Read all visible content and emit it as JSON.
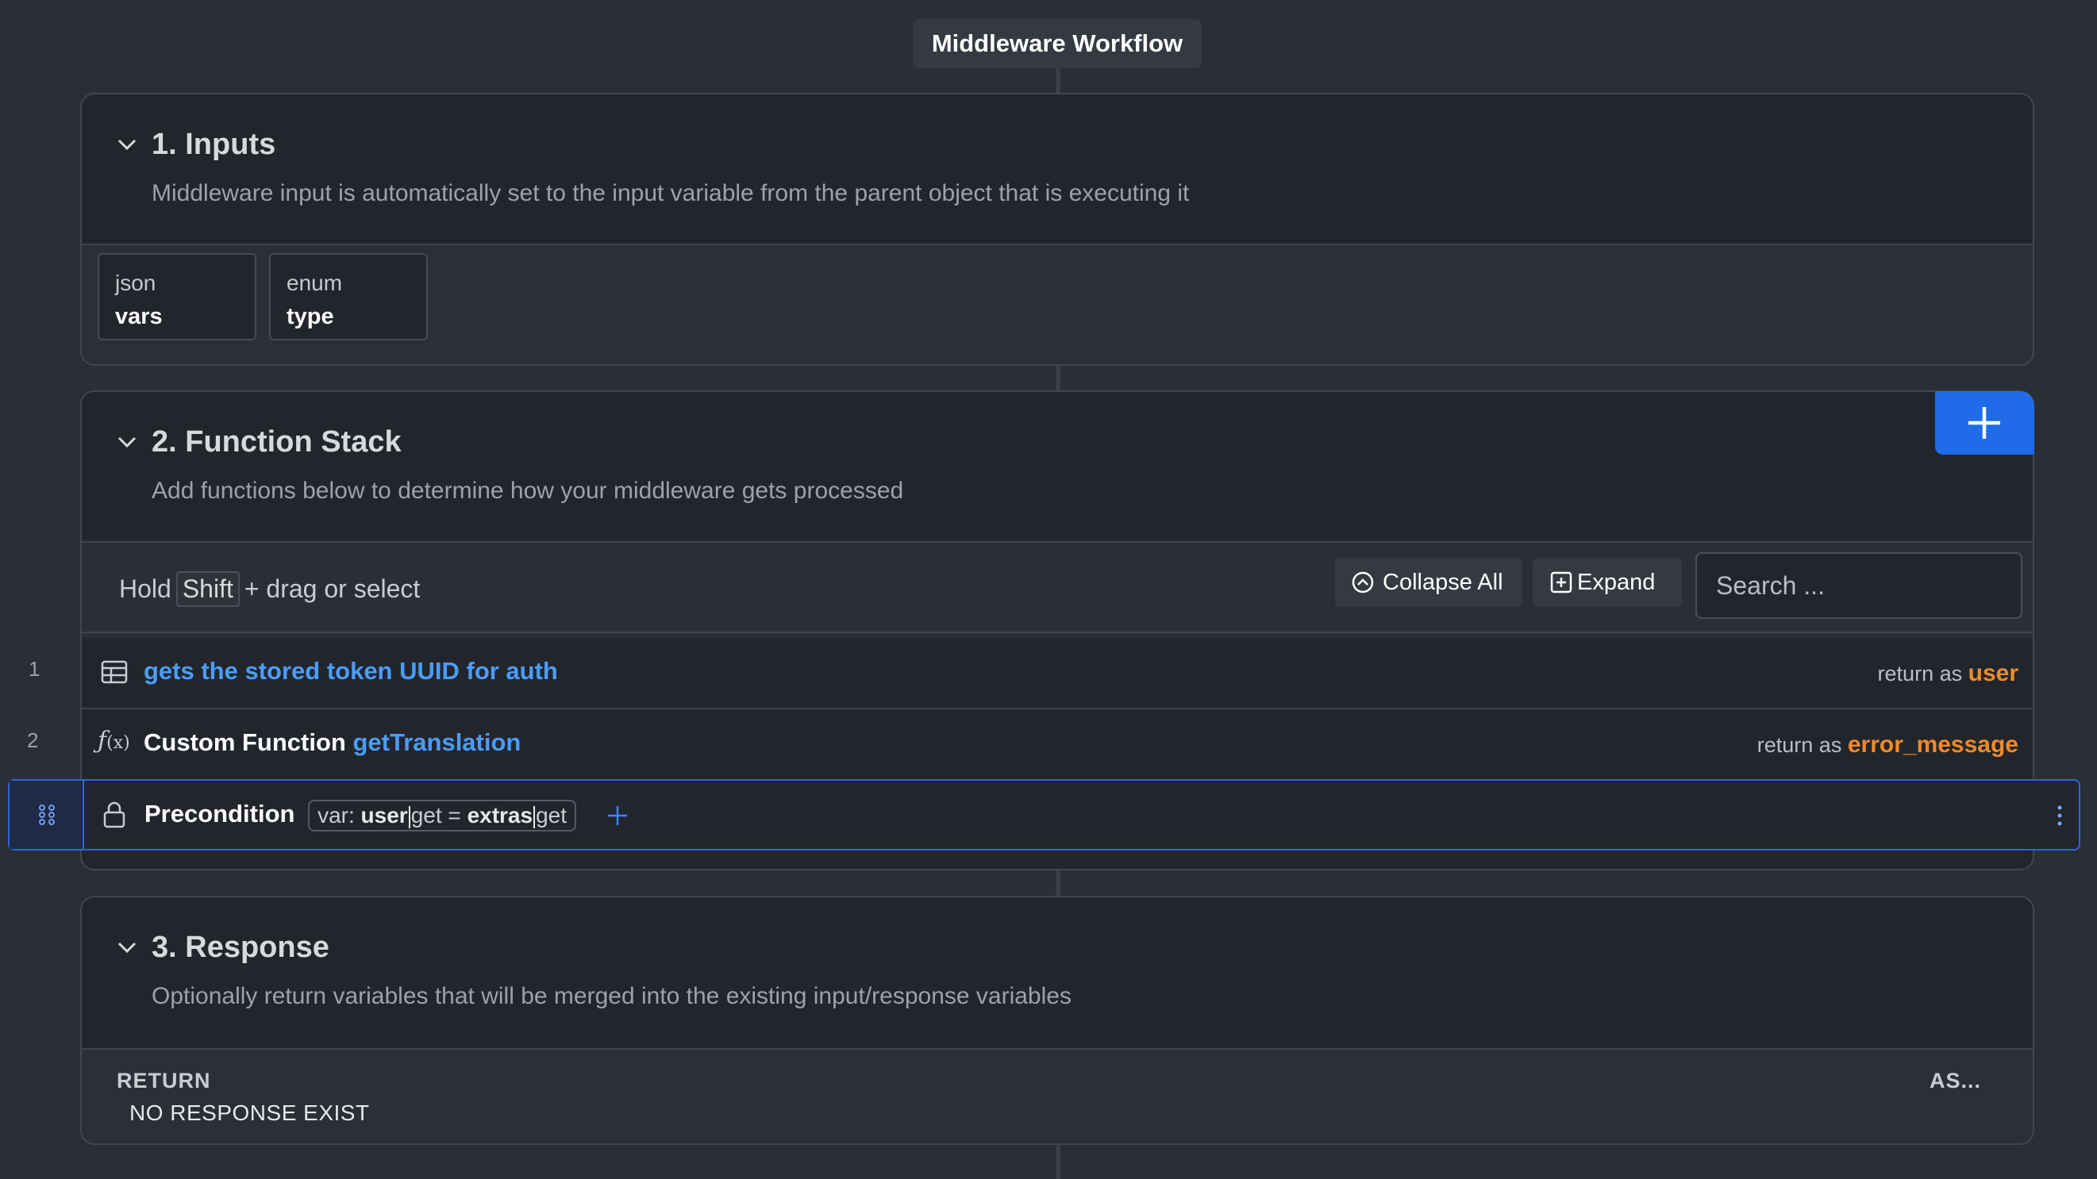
{
  "workflow": {
    "title": "Middleware Workflow"
  },
  "inputs": {
    "title": "1. Inputs",
    "subtitle": "Middleware input is automatically set to the input variable from the parent object that is executing it",
    "items": [
      {
        "type": "json",
        "name": "vars"
      },
      {
        "type": "enum",
        "name": "type"
      }
    ]
  },
  "function_stack": {
    "title": "2. Function Stack",
    "subtitle": "Add functions below to determine how your middleware gets processed",
    "add_button_icon": "plus-icon",
    "toolbar": {
      "hint_pre": "Hold",
      "hint_key": "Shift",
      "hint_post": "+ drag or select",
      "collapse_label": "Collapse All",
      "expand_label": "Expand",
      "search_placeholder": "Search ..."
    },
    "rows": [
      {
        "number": "1",
        "icon": "table-icon",
        "label": "gets the stored token UUID for auth",
        "return_prefix": "return as",
        "return_var": "user"
      },
      {
        "number": "2",
        "icon": "function-icon",
        "prefix": "Custom Function",
        "label": "getTranslation",
        "return_prefix": "return as",
        "return_var": "error_message"
      }
    ],
    "precondition": {
      "label": "Precondition",
      "expr_prefix": "var:",
      "expr_var": "user",
      "expr_get1": "get",
      "expr_eq": "=",
      "expr_val": "extras",
      "expr_get2": "get"
    }
  },
  "response": {
    "title": "3. Response",
    "subtitle": "Optionally return variables that will be merged into the existing input/response variables",
    "return_label": "RETURN",
    "as_label": "AS...",
    "empty_text": "NO RESPONSE EXIST"
  },
  "colors": {
    "accent": "#1f6be8",
    "link": "#4c9cf8",
    "return_var": "#f08a2b",
    "background": "#2a2e35"
  }
}
